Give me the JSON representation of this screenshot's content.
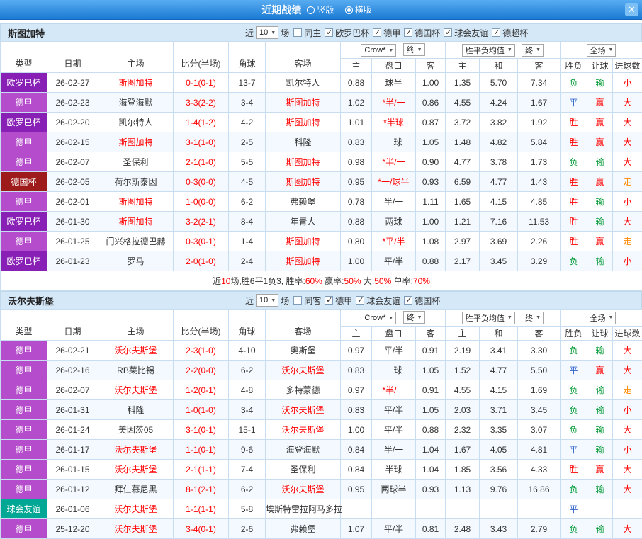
{
  "titlebar": {
    "title": "近期战绩",
    "layout_options": [
      {
        "label": "竖版",
        "selected": false
      },
      {
        "label": "横版",
        "selected": true
      }
    ],
    "close": "✕"
  },
  "labels": {
    "near": "近",
    "games": "场"
  },
  "controls": {
    "count": "10",
    "bookmaker": "Crow*",
    "stage_initial": "终",
    "avg": "胜平负均值",
    "stage_final": "终",
    "scope": "全场"
  },
  "columns": {
    "type": "类型",
    "date": "日期",
    "home": "主场",
    "score": "比分(半场)",
    "corner": "角球",
    "away": "客场",
    "asia_home": "主",
    "asia_line": "盘口",
    "asia_away": "客",
    "euro_home": "主",
    "euro_draw": "和",
    "euro_away": "客",
    "wdl": "胜负",
    "handicap": "让球",
    "goals": "进球数"
  },
  "colors": {
    "red": "#ff0000",
    "green": "#009933",
    "blue": "#3366cc",
    "orange": "#ff8800",
    "text": "#333333",
    "white": "#ffffff"
  },
  "league_colors": {
    "欧罗巴杯": "#8920B6",
    "德甲": "#B44CCB",
    "德国杯": "#9E1B1B",
    "球会友谊": "#00A795",
    "德超杯": "#B44CCB"
  },
  "result_color_map": {
    "胜": "red",
    "平": "blue",
    "负": "green",
    "赢": "red",
    "输": "green",
    "走": "orange",
    "大": "red",
    "小": "red"
  },
  "sections": [
    {
      "team": "斯图加特",
      "same_label": "同主",
      "leagues": [
        "欧罗巴杯",
        "德甲",
        "德国杯",
        "球会友谊",
        "德超杯"
      ],
      "rows": [
        {
          "type": "欧罗巴杯",
          "date": "26-02-27",
          "home": "斯图加特",
          "hhl": true,
          "score": "0-1(0-1)",
          "corner": "13-7",
          "away": "凯尔特人",
          "ahl": false,
          "o1": "0.88",
          "line": "球半",
          "lhl": false,
          "o2": "1.00",
          "e1": "1.35",
          "e2": "5.70",
          "e3": "7.34",
          "wdl": "负",
          "han": "输",
          "big": "小"
        },
        {
          "type": "德甲",
          "date": "26-02-23",
          "home": "海登海默",
          "hhl": false,
          "score": "3-3(2-2)",
          "corner": "3-4",
          "away": "斯图加特",
          "ahl": true,
          "o1": "1.02",
          "line": "*半/一",
          "lhl": true,
          "o2": "0.86",
          "e1": "4.55",
          "e2": "4.24",
          "e3": "1.67",
          "wdl": "平",
          "han": "赢",
          "big": "大"
        },
        {
          "type": "欧罗巴杯",
          "date": "26-02-20",
          "home": "凯尔特人",
          "hhl": false,
          "score": "1-4(1-2)",
          "corner": "4-2",
          "away": "斯图加特",
          "ahl": true,
          "o1": "1.01",
          "line": "*半球",
          "lhl": true,
          "o2": "0.87",
          "e1": "3.72",
          "e2": "3.82",
          "e3": "1.92",
          "wdl": "胜",
          "han": "赢",
          "big": "大"
        },
        {
          "type": "德甲",
          "date": "26-02-15",
          "home": "斯图加特",
          "hhl": true,
          "score": "3-1(1-0)",
          "corner": "2-5",
          "away": "科隆",
          "ahl": false,
          "o1": "0.83",
          "line": "一球",
          "lhl": false,
          "o2": "1.05",
          "e1": "1.48",
          "e2": "4.82",
          "e3": "5.84",
          "wdl": "胜",
          "han": "赢",
          "big": "大"
        },
        {
          "type": "德甲",
          "date": "26-02-07",
          "home": "圣保利",
          "hhl": false,
          "score": "2-1(1-0)",
          "corner": "5-5",
          "away": "斯图加特",
          "ahl": true,
          "o1": "0.98",
          "line": "*半/一",
          "lhl": true,
          "o2": "0.90",
          "e1": "4.77",
          "e2": "3.78",
          "e3": "1.73",
          "wdl": "负",
          "han": "输",
          "big": "大"
        },
        {
          "type": "德国杯",
          "date": "26-02-05",
          "home": "荷尔斯泰因",
          "hhl": false,
          "score": "0-3(0-0)",
          "corner": "4-5",
          "away": "斯图加特",
          "ahl": true,
          "o1": "0.95",
          "line": "*一/球半",
          "lhl": true,
          "o2": "0.93",
          "e1": "6.59",
          "e2": "4.77",
          "e3": "1.43",
          "wdl": "胜",
          "han": "赢",
          "big": "走"
        },
        {
          "type": "德甲",
          "date": "26-02-01",
          "home": "斯图加特",
          "hhl": true,
          "score": "1-0(0-0)",
          "corner": "6-2",
          "away": "弗赖堡",
          "ahl": false,
          "o1": "0.78",
          "line": "半/一",
          "lhl": false,
          "o2": "1.11",
          "e1": "1.65",
          "e2": "4.15",
          "e3": "4.85",
          "wdl": "胜",
          "han": "输",
          "big": "小"
        },
        {
          "type": "欧罗巴杯",
          "date": "26-01-30",
          "home": "斯图加特",
          "hhl": true,
          "score": "3-2(2-1)",
          "corner": "8-4",
          "away": "年青人",
          "ahl": false,
          "o1": "0.88",
          "line": "两球",
          "lhl": false,
          "o2": "1.00",
          "e1": "1.21",
          "e2": "7.16",
          "e3": "11.53",
          "wdl": "胜",
          "han": "输",
          "big": "大"
        },
        {
          "type": "德甲",
          "date": "26-01-25",
          "home": "门兴格拉德巴赫",
          "hhl": false,
          "score": "0-3(0-1)",
          "corner": "1-4",
          "away": "斯图加特",
          "ahl": true,
          "o1": "0.80",
          "line": "*平/半",
          "lhl": true,
          "o2": "1.08",
          "e1": "2.97",
          "e2": "3.69",
          "e3": "2.26",
          "wdl": "胜",
          "han": "赢",
          "big": "走"
        },
        {
          "type": "欧罗巴杯",
          "date": "26-01-23",
          "home": "罗马",
          "hhl": false,
          "score": "2-0(1-0)",
          "corner": "2-4",
          "away": "斯图加特",
          "ahl": true,
          "o1": "1.00",
          "line": "平/半",
          "lhl": false,
          "o2": "0.88",
          "e1": "2.17",
          "e2": "3.45",
          "e3": "3.29",
          "wdl": "负",
          "han": "输",
          "big": "小"
        }
      ],
      "summary": [
        {
          "t": "近"
        },
        {
          "t": "10",
          "red": true
        },
        {
          "t": "场,胜6平1负3, "
        },
        {
          "t": "胜率:"
        },
        {
          "t": "60%",
          "red": true
        },
        {
          "t": " 赢率:"
        },
        {
          "t": "50%",
          "red": true
        },
        {
          "t": " 大:"
        },
        {
          "t": "50%",
          "red": true
        },
        {
          "t": " 单率:"
        },
        {
          "t": "70%",
          "red": true
        }
      ]
    },
    {
      "team": "沃尔夫斯堡",
      "same_label": "同客",
      "leagues": [
        "德甲",
        "球会友谊",
        "德国杯"
      ],
      "rows": [
        {
          "type": "德甲",
          "date": "26-02-21",
          "home": "沃尔夫斯堡",
          "hhl": true,
          "score": "2-3(1-0)",
          "corner": "4-10",
          "away": "奥斯堡",
          "ahl": false,
          "o1": "0.97",
          "line": "平/半",
          "lhl": false,
          "o2": "0.91",
          "e1": "2.19",
          "e2": "3.41",
          "e3": "3.30",
          "wdl": "负",
          "han": "输",
          "big": "大"
        },
        {
          "type": "德甲",
          "date": "26-02-16",
          "home": "RB莱比锡",
          "hhl": false,
          "score": "2-2(0-0)",
          "corner": "6-2",
          "away": "沃尔夫斯堡",
          "ahl": true,
          "o1": "0.83",
          "line": "一球",
          "lhl": false,
          "o2": "1.05",
          "e1": "1.52",
          "e2": "4.77",
          "e3": "5.50",
          "wdl": "平",
          "han": "赢",
          "big": "大"
        },
        {
          "type": "德甲",
          "date": "26-02-07",
          "home": "沃尔夫斯堡",
          "hhl": true,
          "score": "1-2(0-1)",
          "corner": "4-8",
          "away": "多特蒙德",
          "ahl": false,
          "o1": "0.97",
          "line": "*半/一",
          "lhl": true,
          "o2": "0.91",
          "e1": "4.55",
          "e2": "4.15",
          "e3": "1.69",
          "wdl": "负",
          "han": "输",
          "big": "走"
        },
        {
          "type": "德甲",
          "date": "26-01-31",
          "home": "科隆",
          "hhl": false,
          "score": "1-0(1-0)",
          "corner": "3-4",
          "away": "沃尔夫斯堡",
          "ahl": true,
          "o1": "0.83",
          "line": "平/半",
          "lhl": false,
          "o2": "1.05",
          "e1": "2.03",
          "e2": "3.71",
          "e3": "3.45",
          "wdl": "负",
          "han": "输",
          "big": "小"
        },
        {
          "type": "德甲",
          "date": "26-01-24",
          "home": "美因茨05",
          "hhl": false,
          "score": "3-1(0-1)",
          "corner": "15-1",
          "away": "沃尔夫斯堡",
          "ahl": true,
          "o1": "1.00",
          "line": "平/半",
          "lhl": false,
          "o2": "0.88",
          "e1": "2.32",
          "e2": "3.35",
          "e3": "3.07",
          "wdl": "负",
          "han": "输",
          "big": "大"
        },
        {
          "type": "德甲",
          "date": "26-01-17",
          "home": "沃尔夫斯堡",
          "hhl": true,
          "score": "1-1(0-1)",
          "corner": "9-6",
          "away": "海登海默",
          "ahl": false,
          "o1": "0.84",
          "line": "半/一",
          "lhl": false,
          "o2": "1.04",
          "e1": "1.67",
          "e2": "4.05",
          "e3": "4.81",
          "wdl": "平",
          "han": "输",
          "big": "小"
        },
        {
          "type": "德甲",
          "date": "26-01-15",
          "home": "沃尔夫斯堡",
          "hhl": true,
          "score": "2-1(1-1)",
          "corner": "7-4",
          "away": "圣保利",
          "ahl": false,
          "o1": "0.84",
          "line": "半球",
          "lhl": false,
          "o2": "1.04",
          "e1": "1.85",
          "e2": "3.56",
          "e3": "4.33",
          "wdl": "胜",
          "han": "赢",
          "big": "大"
        },
        {
          "type": "德甲",
          "date": "26-01-12",
          "home": "拜仁慕尼黑",
          "hhl": false,
          "score": "8-1(2-1)",
          "corner": "6-2",
          "away": "沃尔夫斯堡",
          "ahl": true,
          "o1": "0.95",
          "line": "两球半",
          "lhl": false,
          "o2": "0.93",
          "e1": "1.13",
          "e2": "9.76",
          "e3": "16.86",
          "wdl": "负",
          "han": "输",
          "big": "大"
        },
        {
          "type": "球会友谊",
          "date": "26-01-06",
          "home": "沃尔夫斯堡",
          "hhl": true,
          "score": "1-1(1-1)",
          "corner": "5-8",
          "away": "埃斯特雷拉阿马多拉",
          "ahl": false,
          "o1": "",
          "line": "",
          "lhl": false,
          "o2": "",
          "e1": "",
          "e2": "",
          "e3": "",
          "wdl": "平",
          "han": "",
          "big": ""
        },
        {
          "type": "德甲",
          "date": "25-12-20",
          "home": "沃尔夫斯堡",
          "hhl": true,
          "score": "3-4(0-1)",
          "corner": "2-6",
          "away": "弗赖堡",
          "ahl": false,
          "o1": "1.07",
          "line": "平/半",
          "lhl": false,
          "o2": "0.81",
          "e1": "2.48",
          "e2": "3.43",
          "e3": "2.79",
          "wdl": "负",
          "han": "输",
          "big": "大"
        }
      ]
    }
  ]
}
